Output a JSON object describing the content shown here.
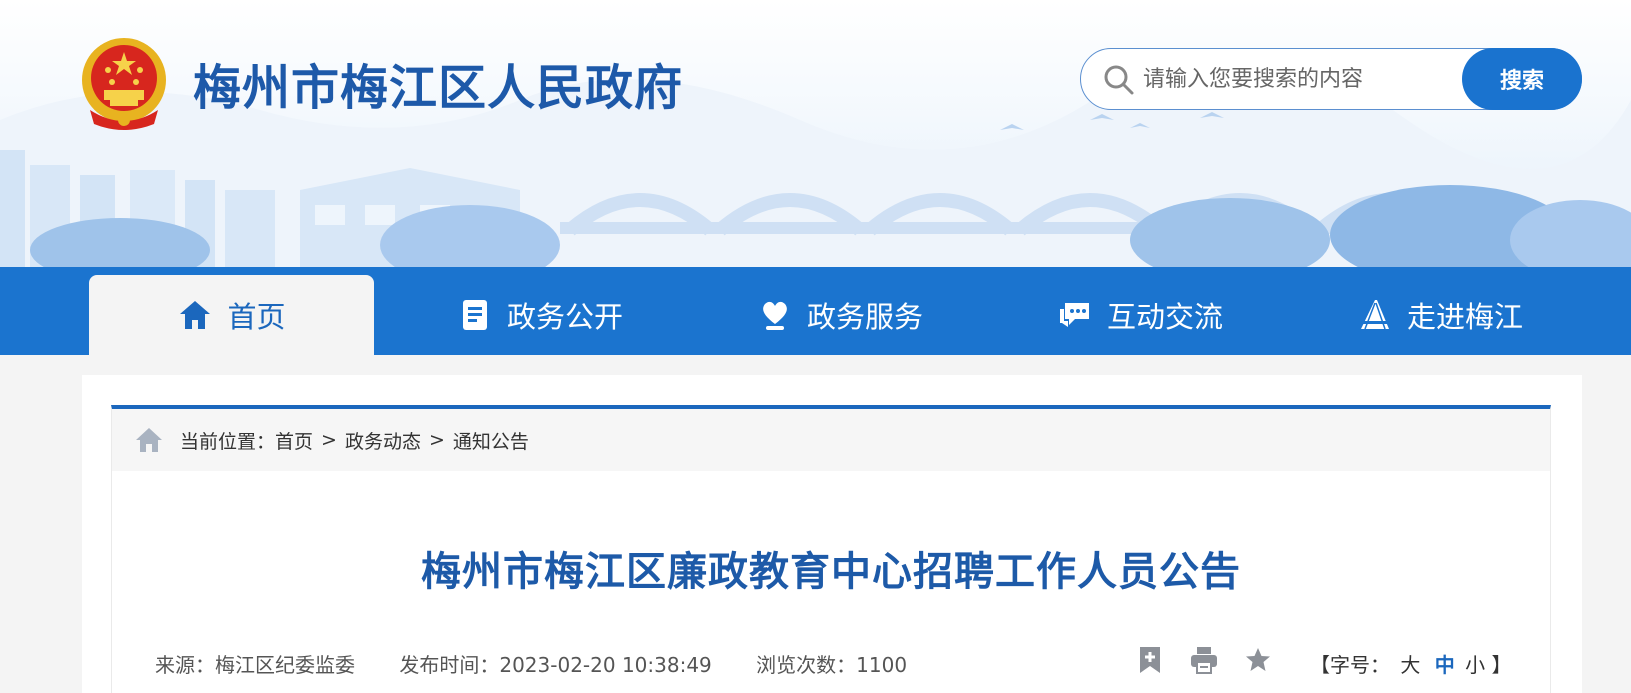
{
  "header": {
    "site_title": "梅州市梅江区人民政府",
    "search_placeholder": "请输入您要搜索的内容",
    "search_button": "搜索"
  },
  "nav": {
    "items": [
      {
        "label": "首页",
        "icon": "home-icon",
        "active": true
      },
      {
        "label": "政务公开",
        "icon": "document-icon",
        "active": false
      },
      {
        "label": "政务服务",
        "icon": "service-icon",
        "active": false
      },
      {
        "label": "互动交流",
        "icon": "chat-icon",
        "active": false
      },
      {
        "label": "走进梅江",
        "icon": "landmark-icon",
        "active": false
      }
    ]
  },
  "breadcrumb": {
    "prefix": "当前位置：",
    "items": [
      "首页",
      "政务动态",
      "通知公告"
    ],
    "separator": ">"
  },
  "article": {
    "title": "梅州市梅江区廉政教育中心招聘工作人员公告",
    "source": "来源：梅江区纪委监委",
    "publish_time": "发布时间：2023-02-20 10:38:49",
    "views": "浏览次数：1100"
  },
  "fontsize": {
    "open": "【字号：",
    "large": "大",
    "medium": "中",
    "small": "小",
    "close": "】"
  },
  "colors": {
    "brand_blue": "#1b74cf",
    "title_blue": "#1d5aa8"
  }
}
